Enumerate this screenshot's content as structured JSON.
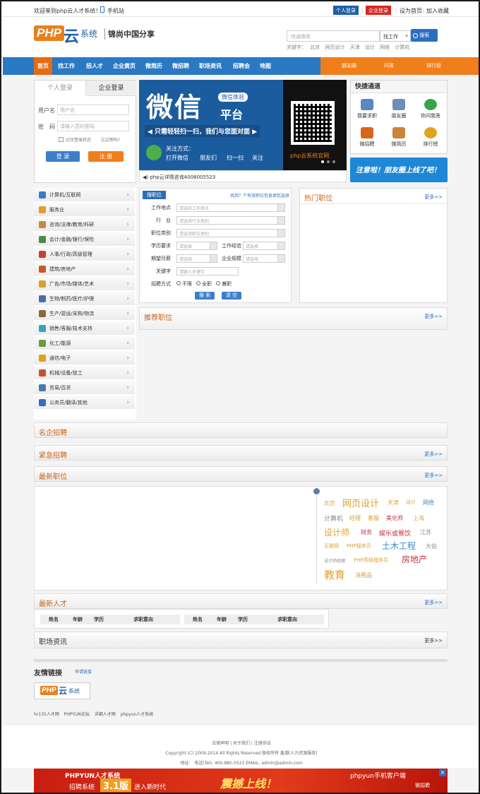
{
  "topbar": {
    "welcome": "欢迎来到php云人才系统！",
    "mobile": "手机站",
    "personal_login": "个人登录",
    "company_login": "企业登录",
    "set_home": "设为首页",
    "favorite": "加入收藏"
  },
  "header": {
    "logo_php": "PHP",
    "logo_yun": "云",
    "logo_sys": "系统",
    "slogan": "锦尚中国分享",
    "search_placeholder": "快速搜索",
    "search_type": "找工作",
    "search_button": "搜索",
    "hot_label": "关键字：",
    "hot_words": [
      "北京",
      "网页设计",
      "天津",
      "设计",
      "网络",
      "计算机"
    ]
  },
  "nav": {
    "items": [
      "首页",
      "找工作",
      "招人才",
      "企业黄页",
      "微简历",
      "微招聘",
      "职场资讯",
      "招聘会",
      "地图"
    ],
    "right": [
      "朋友圈",
      "问答",
      "排行榜"
    ]
  },
  "login": {
    "tab_personal": "个人登录",
    "tab_company": "企业登录",
    "user_label": "用户名",
    "user_placeholder": "用户名",
    "pass_label": "密　码",
    "pass_placeholder": "请输入您的密码",
    "remember": "记住登录状态",
    "forgot": "忘记密码?",
    "login_button": "登 录",
    "register_button": "注 册"
  },
  "banner": {
    "big": "微信",
    "tag": "微信体验",
    "tag2": "平台",
    "sub": "◀ 只需轻轻扫一扫，我们与您面对面 ▶",
    "follow": "关注方式：",
    "steps": [
      "打开微信",
      "朋友们",
      "扫一扫",
      "关注"
    ],
    "brand": "php云系统官网"
  },
  "ticker": "◀) php云详情咨询4008005523",
  "quick": {
    "title": "快捷通道",
    "items": [
      {
        "label": "我要求职",
        "color": "#5b86c4"
      },
      {
        "label": "朋友圈",
        "color": "#6b8fb8"
      },
      {
        "label": "你问我答",
        "color": "#3aa34a"
      },
      {
        "label": "微招聘",
        "color": "#d9651b"
      },
      {
        "label": "微简历",
        "color": "#c9853a"
      },
      {
        "label": "排行榜",
        "color": "#e0a41c"
      }
    ],
    "ad": "注意啦！朋友圈上线了吧！"
  },
  "categories": [
    {
      "label": "计算机/互联网",
      "color": "#3a7cc8"
    },
    {
      "label": "服务业",
      "color": "#e69a2e"
    },
    {
      "label": "咨询/法律/教育/科研",
      "color": "#c78a3a"
    },
    {
      "label": "会计/金融/银行/保险",
      "color": "#4a8a4a"
    },
    {
      "label": "人事/行政/高级管理",
      "color": "#c8402a"
    },
    {
      "label": "建筑/房地产",
      "color": "#c25a2a"
    },
    {
      "label": "广告/市场/媒体/艺术",
      "color": "#d9a02a"
    },
    {
      "label": "生物/制药/医疗/护理",
      "color": "#4a6fa8"
    },
    {
      "label": "生产/营运/采购/物流",
      "color": "#8a6a3a"
    },
    {
      "label": "销售/客服/技术支持",
      "color": "#3aa0c8"
    },
    {
      "label": "化工/能源",
      "color": "#6a9a3a"
    },
    {
      "label": "通信/电子",
      "color": "#e0a020"
    },
    {
      "label": "机械/设备/技工",
      "color": "#c8502a"
    },
    {
      "label": "贸易/百货",
      "color": "#4a7aa8"
    },
    {
      "label": "公务员/翻译/其他",
      "color": "#3a6ac8"
    }
  ],
  "search_panel": {
    "title": "搜职位",
    "link": "找到？个有效职位信息供您选择",
    "rows": {
      "location": {
        "label": "工作地点",
        "value": "请选择工作地点"
      },
      "industry": {
        "label": "行　业",
        "value": "请选择行业类别"
      },
      "category": {
        "label": "职位类别",
        "value": "请选择职位类别"
      },
      "education": {
        "label": "学历要求",
        "value": "请选择"
      },
      "experience": {
        "label": "工作经验",
        "value": "请选择"
      },
      "salary": {
        "label": "期望月薪",
        "value": "请选择"
      },
      "scale": {
        "label": "企业规模",
        "value": "请选择"
      },
      "keyword": {
        "label": "关键字",
        "value": "请输入关键字"
      },
      "mode": {
        "label": "招聘方式",
        "options": [
          "不限",
          "全职",
          "兼职"
        ]
      }
    },
    "search_button": "搜 索",
    "clear_button": "清 空"
  },
  "panels": {
    "hot_jobs": "热门职位",
    "recommend": "推荐职位",
    "famous": "名企招聘",
    "urgent": "紧急招聘",
    "latest_jobs": "最新职位",
    "latest_talent": "最新人才",
    "news": "职场资讯",
    "more": "更多>>"
  },
  "tag_cloud": [
    {
      "w": "北京",
      "c": "#e0a030"
    },
    {
      "w": "网页设计",
      "c": "#d9a030"
    },
    {
      "w": "天津",
      "c": "#e0a030"
    },
    {
      "w": "设计",
      "c": "#e0a030"
    },
    {
      "w": "网络",
      "c": "#3a8ac8"
    },
    {
      "w": "计算机",
      "c": "#888888"
    },
    {
      "w": "经理",
      "c": "#d9a030"
    },
    {
      "w": "客服",
      "c": "#d9a030"
    },
    {
      "w": "美化师",
      "c": "#c8303a"
    },
    {
      "w": "上海",
      "c": "#e0a030"
    },
    {
      "w": "设计师",
      "c": "#e0a030"
    },
    {
      "w": "财务",
      "c": "#c8303a"
    },
    {
      "w": "娱乐或餐饮",
      "c": "#c8303a"
    },
    {
      "w": "江苏",
      "c": "#888888"
    },
    {
      "w": "互联网",
      "c": "#e0a030"
    },
    {
      "w": "PHP程序员",
      "c": "#d9a030"
    },
    {
      "w": "土木工程",
      "c": "#3a8ac8"
    },
    {
      "w": "大伯",
      "c": "#888888"
    },
    {
      "w": "设计师经理",
      "c": "#888888"
    },
    {
      "w": "PHP高级程序员",
      "c": "#e0a030"
    },
    {
      "w": "房地产",
      "c": "#c8303a"
    },
    {
      "w": "教育",
      "c": "#e0a030"
    },
    {
      "w": "消费品",
      "c": "#d9a030"
    }
  ],
  "talent_cols": [
    "姓名",
    "年龄",
    "学历",
    "求职意向"
  ],
  "links": {
    "title": "友情链接",
    "apply": "申请链接",
    "items": [
      "hr135人才网",
      "PHPYUN论坛",
      "详细人才网",
      "phpyun人才系统"
    ]
  },
  "footer": {
    "links": "法律声明 | 关于我们 | 注册协议",
    "copyright": "Copyright (C) 2009-2014 All Rights Reserved 版权所有 鑫潮(人力资源服务)",
    "address": "地址： 电话(Tel): 400-880-5523 EMAIL: admin@admin.com"
  },
  "bottom_ad": {
    "left1": "PHPYUN人才系统",
    "left2": "招聘系统",
    "version": "3.1版",
    "new": "进入新时代",
    "big": "震撼上线！",
    "right1": "phpyun手机客户端",
    "right2": "微招聘"
  }
}
